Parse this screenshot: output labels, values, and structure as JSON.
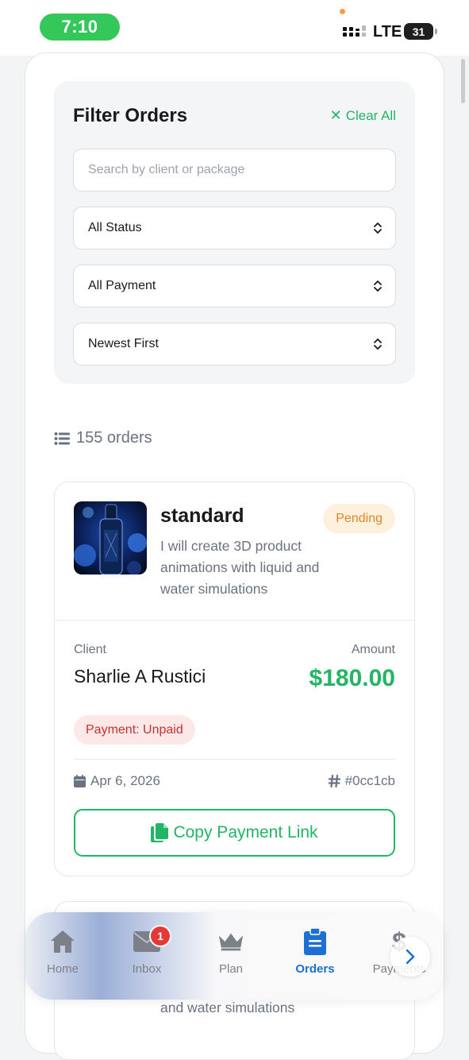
{
  "status_bar": {
    "time": "7:10",
    "network": "LTE",
    "battery": "31"
  },
  "filter": {
    "title": "Filter Orders",
    "clear_all": "Clear All",
    "search_placeholder": "Search by client or package",
    "status_select": "All Status",
    "payment_select": "All Payment",
    "sort_select": "Newest First"
  },
  "orders_count": "155 orders",
  "order": {
    "package": "standard",
    "status": "Pending",
    "description": "I will create 3D product animations with liquid and water simulations",
    "client_label": "Client",
    "client_name": "Sharlie A Rustici",
    "amount_label": "Amount",
    "amount": "$180.00",
    "payment_status": "Payment: Unpaid",
    "date": "Apr 6, 2026",
    "order_id": "#0cc1cb",
    "copy_button": "Copy Payment Link"
  },
  "next_order": {
    "description_fragment": "and water simulations"
  },
  "nav": {
    "items": [
      {
        "label": "Home",
        "icon": "home-icon"
      },
      {
        "label": "Inbox",
        "icon": "envelope-icon",
        "badge": "1"
      },
      {
        "label": "Plan",
        "icon": "crown-icon"
      },
      {
        "label": "Orders",
        "icon": "clipboard-icon",
        "active": true
      },
      {
        "label": "Payments",
        "icon": "dollar-icon"
      }
    ]
  },
  "colors": {
    "accent_green": "#22b565",
    "active_blue": "#1d6fd6",
    "pending_orange": "#d9892b",
    "unpaid_red": "#c53030"
  }
}
